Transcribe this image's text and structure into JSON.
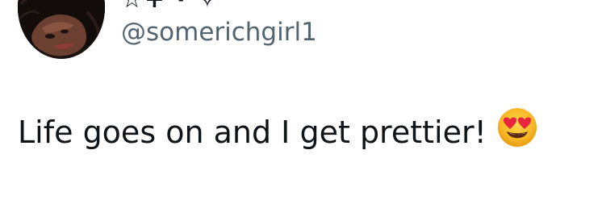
{
  "header": {
    "display_name": "☆+ · ✧",
    "handle": "@somerichgirl1"
  },
  "tweet": {
    "text": "Life goes on and I get prettier!",
    "emoji": "heart-eyes-emoji"
  },
  "colors": {
    "text_primary": "#0f1419",
    "text_secondary": "#536471",
    "emoji_face": "#f7b625",
    "emoji_hearts": "#e8253c"
  }
}
